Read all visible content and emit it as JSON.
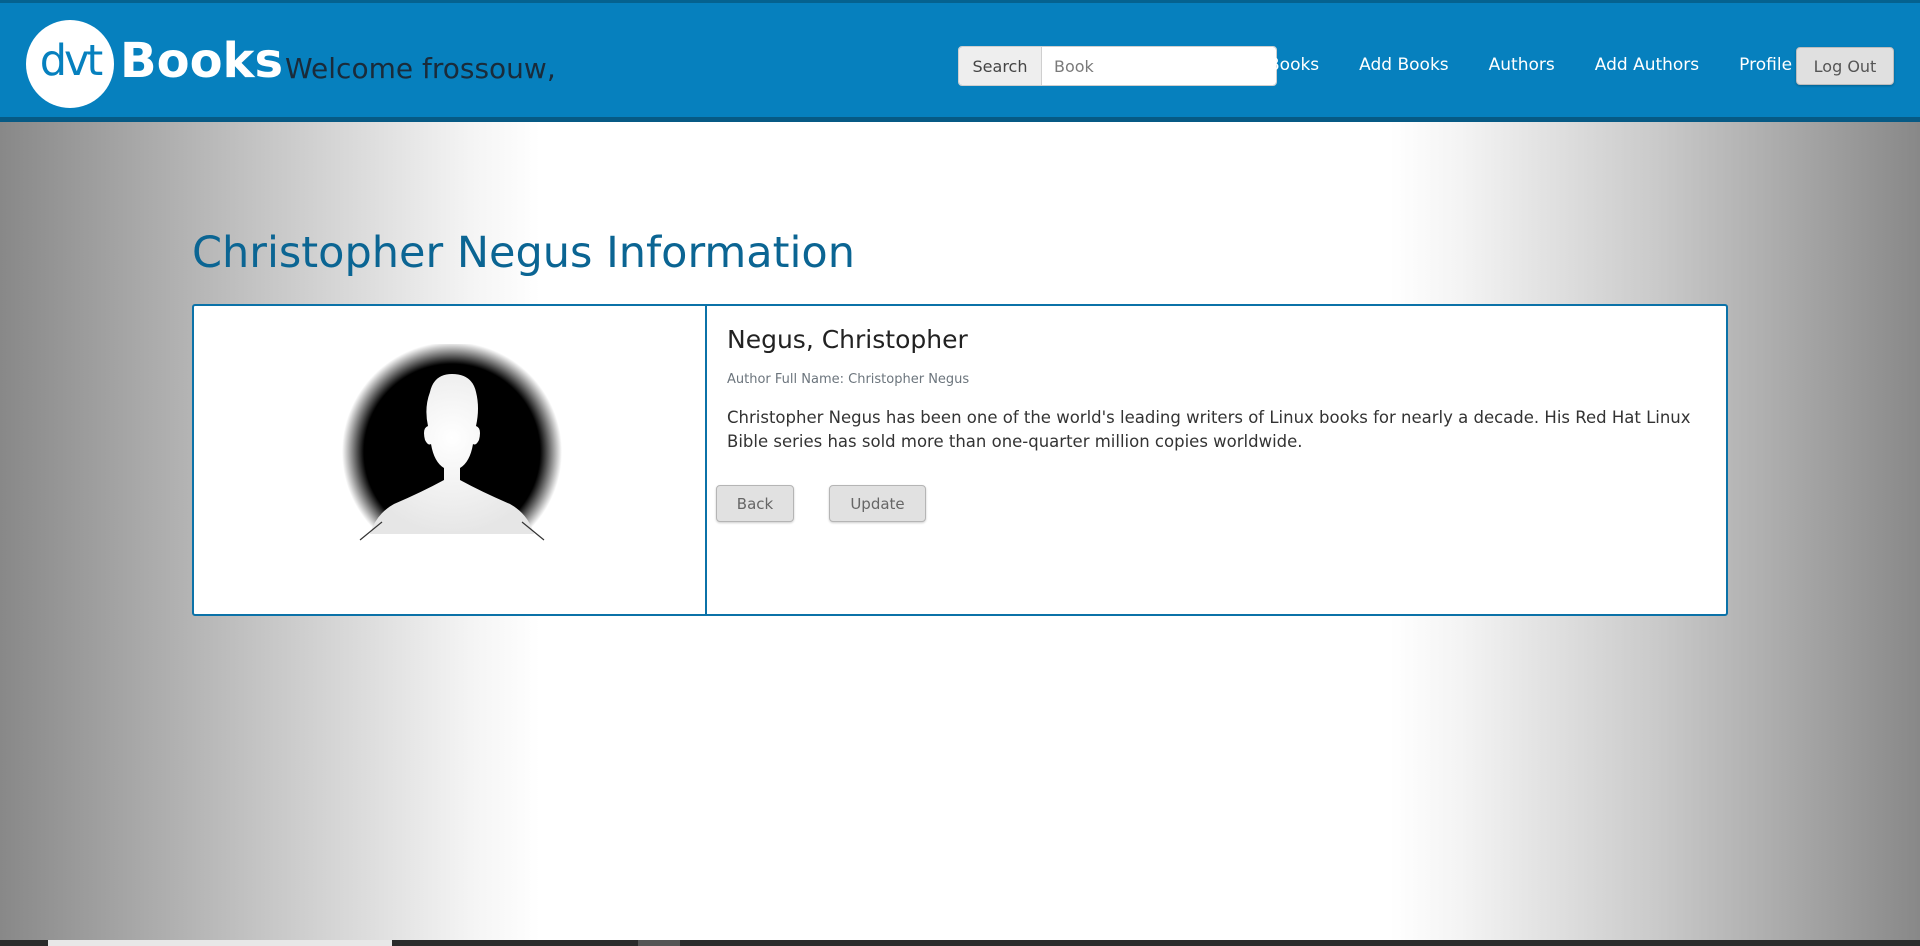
{
  "navbar": {
    "logo_text": "dvt",
    "brand": "Books",
    "welcome": "Welcome frossouw,",
    "search": {
      "label": "Search",
      "placeholder": "Book",
      "value": ""
    },
    "links": [
      {
        "label": "Books"
      },
      {
        "label": "Add Books"
      },
      {
        "label": "Authors"
      },
      {
        "label": "Add Authors"
      },
      {
        "label": "Profile"
      }
    ],
    "logout_label": "Log Out"
  },
  "page": {
    "title": "Christopher Negus Information"
  },
  "author": {
    "name": "Negus, Christopher",
    "full_name": "Author Full Name: Christopher Negus",
    "bio": "Christopher Negus has been one of the world's leading writers of Linux books for nearly a decade. His Red Hat Linux Bible series has sold more than one-quarter million copies worldwide.",
    "image_icon": "person-silhouette-icon"
  },
  "actions": {
    "back_label": "Back",
    "update_label": "Update"
  },
  "colors": {
    "navbar_bg": "#0680be",
    "title_color": "#0b6593",
    "card_border": "#0b72a8"
  }
}
